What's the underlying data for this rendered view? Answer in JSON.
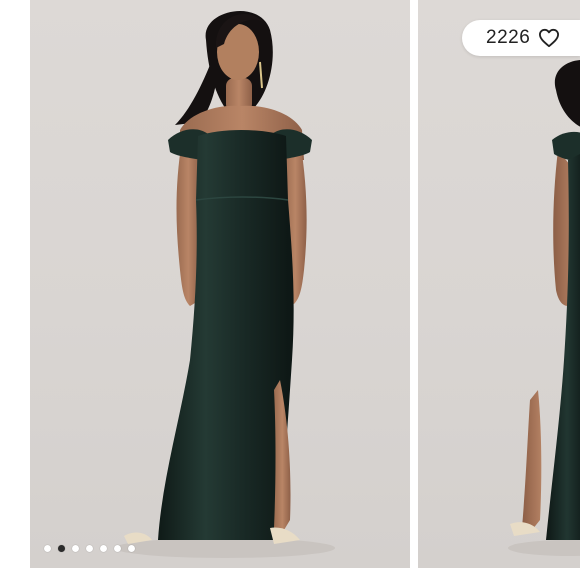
{
  "listing": {
    "like_count": "2226",
    "like_icon": "heart-outline-icon"
  },
  "gallery": {
    "slides": [
      {
        "subject": "model-front-view",
        "dress_color": "#1b2a26"
      },
      {
        "subject": "model-back-view",
        "dress_color": "#1b2a26"
      }
    ],
    "current_index": 1,
    "total_images": 7
  },
  "colors": {
    "backdrop": "#dad6d3",
    "dress": "#1b2a26",
    "pill_background": "#ffffff",
    "text": "#222222",
    "dot_active": "#2b2b2b",
    "dot_inactive": "#ffffff"
  }
}
